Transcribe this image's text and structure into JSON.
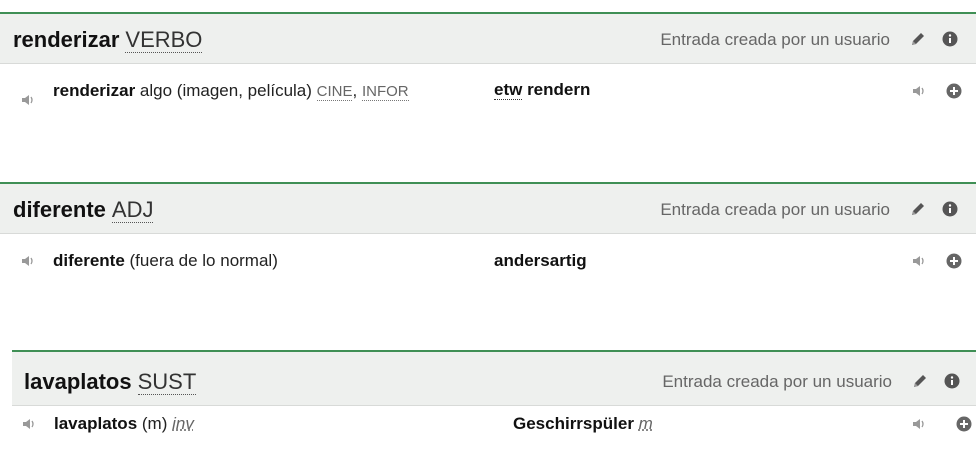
{
  "entries": [
    {
      "headword": "renderizar",
      "pos": "VERBO",
      "created_by": "Entrada creada por un usuario",
      "source": {
        "term": "renderizar",
        "rest": " algo (imagen, película) ",
        "tag1": "CINE",
        "sep": ", ",
        "tag2": "INFOR"
      },
      "target": {
        "abbr": "etw",
        "term": " rendern"
      }
    },
    {
      "headword": "diferente",
      "pos": "ADJ",
      "created_by": "Entrada creada por un usuario",
      "source": {
        "term": "diferente",
        "rest": " (fuera de lo normal)"
      },
      "target": {
        "term": "andersartig"
      }
    },
    {
      "headword": "lavaplatos",
      "pos": "SUST",
      "created_by": "Entrada creada por un usuario",
      "source": {
        "term": "lavaplatos",
        "rest": " (m) ",
        "gender": "inv"
      },
      "target": {
        "term": "Geschirrspüler ",
        "gender": "m"
      }
    }
  ],
  "icons": {
    "speaker": "speaker-icon",
    "pencil": "pencil-icon",
    "info": "info-icon",
    "plus": "plus-circle-icon"
  },
  "colors": {
    "header_border": "#3f8f55",
    "header_bg": "#eef0ee",
    "muted_text": "#666666"
  }
}
